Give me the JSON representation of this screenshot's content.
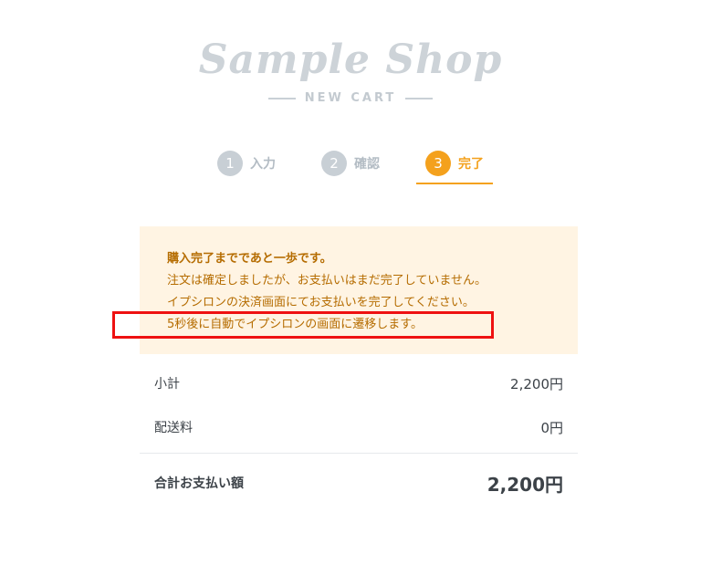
{
  "logo": {
    "name": "Sample Shop",
    "subtitle": "NEW CART"
  },
  "steps": [
    {
      "num": "1",
      "label": "入力"
    },
    {
      "num": "2",
      "label": "確認"
    },
    {
      "num": "3",
      "label": "完了"
    }
  ],
  "notice": {
    "line1": "購入完了までであと一歩です。",
    "line2": "注文は確定しましたが、お支払いはまだ完了していません。",
    "line3": "イプシロンの決済画面にてお支払いを完了してください。",
    "line4": "5秒後に自動でイプシロンの画面に遷移します。"
  },
  "summary": {
    "subtotal_label": "小計",
    "subtotal_value": "2,200円",
    "shipping_label": "配送料",
    "shipping_value": "0円",
    "total_label": "合計お支払い額",
    "total_value": "2,200円"
  },
  "colors": {
    "accent": "#f4a11d",
    "notice_bg": "#fff4e3",
    "notice_text": "#b56c00",
    "highlight": "#ee1111",
    "step_inactive": "#c8cfd5"
  }
}
